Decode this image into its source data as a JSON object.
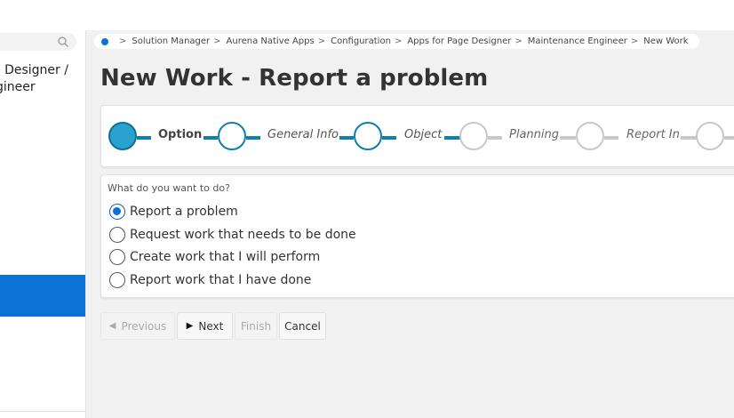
{
  "sidebar": {
    "path_line1": "e Designer /",
    "path_line2": "gineer"
  },
  "breadcrumb": {
    "items": [
      "Solution Manager",
      "Aurena Native Apps",
      "Configuration",
      "Apps for Page Designer",
      "Maintenance Engineer",
      "New Work"
    ],
    "separator": ">"
  },
  "page": {
    "title": "New Work - Report a problem"
  },
  "wizard": {
    "steps": [
      {
        "label": "Option",
        "state": "active"
      },
      {
        "label": "General Info",
        "state": "pending"
      },
      {
        "label": "Object",
        "state": "pending"
      },
      {
        "label": "Planning",
        "state": "future"
      },
      {
        "label": "Report In",
        "state": "future"
      }
    ]
  },
  "form": {
    "question": "What do you want to do?",
    "options": [
      {
        "label": "Report a problem",
        "checked": true
      },
      {
        "label": "Request work that needs to be done",
        "checked": false
      },
      {
        "label": "Create work that I will perform",
        "checked": false
      },
      {
        "label": "Report work that I have done",
        "checked": false
      }
    ]
  },
  "footer": {
    "previous": "Previous",
    "next": "Next",
    "finish": "Finish",
    "cancel": "Cancel"
  },
  "colors": {
    "accent": "#0b72d6",
    "step_active": "#2aa2d0",
    "step_line": "#0f7fad",
    "step_future": "#c8c8c8"
  }
}
